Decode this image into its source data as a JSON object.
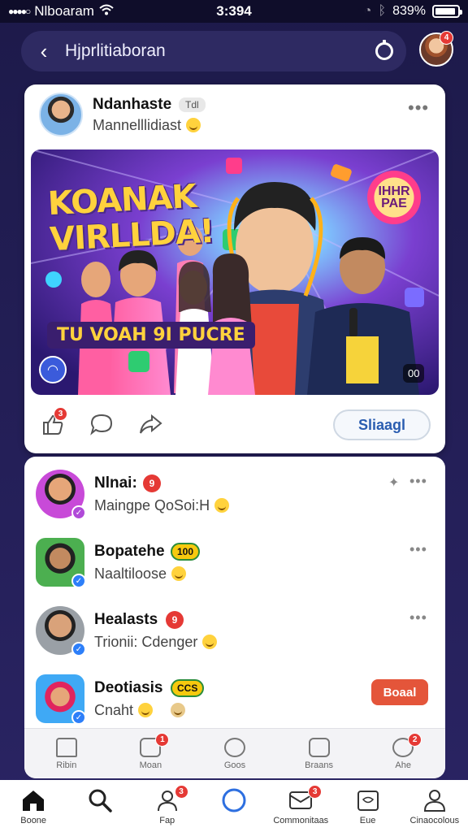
{
  "status_bar": {
    "carrier": "Nlboaram",
    "time": "3:394",
    "battery": "839%"
  },
  "header": {
    "search_text": "Hjprlitiaboran"
  },
  "post": {
    "author": "Ndanhaste",
    "tag": "Tdl",
    "subtitle": "Mannelllidiast",
    "image": {
      "headline_line1": "KOANAK",
      "headline_line2": "VIRLLDA!",
      "subtitle": "TU VOAH 9I PUCRE",
      "logo_text": "IHHR PAE",
      "video_badge": "00"
    },
    "action_button": "Sliaagl"
  },
  "list": {
    "items": [
      {
        "name": "Nlnai:",
        "badge": "9",
        "subtitle": "Maingpe QoSoi:H"
      },
      {
        "name": "Bopatehe",
        "badge": "100",
        "subtitle": "Naaltiloose"
      },
      {
        "name": "Healasts",
        "badge": "9",
        "subtitle": "Trionii: Cdenger"
      },
      {
        "name": "Deotiasis",
        "badge": "CCS",
        "subtitle": "Cnaht",
        "action": "Boaal"
      }
    ]
  },
  "inner_tabs": [
    "Ribin",
    "Moan",
    "Goos",
    "Braans",
    "Ahe"
  ],
  "bottom_nav": [
    {
      "label": "Boone",
      "icon": "home-icon",
      "badge": ""
    },
    {
      "label": "",
      "icon": "search-icon",
      "badge": ""
    },
    {
      "label": "Fap",
      "icon": "people-icon",
      "badge": "3"
    },
    {
      "label": "",
      "icon": "create-icon",
      "badge": ""
    },
    {
      "label": "Commonitaas",
      "icon": "inbox-icon",
      "badge": "3"
    },
    {
      "label": "Eue",
      "icon": "calendar-icon",
      "badge": ""
    },
    {
      "label": "Cinaocolous",
      "icon": "profile-icon",
      "badge": ""
    }
  ]
}
